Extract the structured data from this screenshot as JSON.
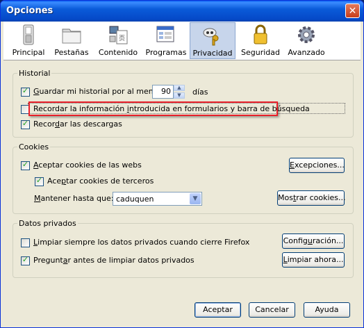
{
  "window": {
    "title": "Opciones",
    "close_glyph": "✕"
  },
  "toolbar": {
    "items": [
      {
        "label": "Principal",
        "icon": "switch-icon"
      },
      {
        "label": "Pestañas",
        "icon": "folder-tabs-icon"
      },
      {
        "label": "Contenido",
        "icon": "content-icon"
      },
      {
        "label": "Programas",
        "icon": "applications-icon"
      },
      {
        "label": "Privacidad",
        "icon": "mask-key-icon",
        "active": true
      },
      {
        "label": "Seguridad",
        "icon": "lock-icon"
      },
      {
        "label": "Avanzado",
        "icon": "gear-icon"
      }
    ]
  },
  "historial": {
    "legend": "Historial",
    "save_history": {
      "pre": "",
      "ul": "G",
      "post": "uardar mi historial por al menos",
      "checked": true
    },
    "days_value": "90",
    "days_label": "días",
    "remember_forms": {
      "pre": "Recordar la información ",
      "ul": "i",
      "post": "ntroducida en formularios y barra de búsqueda",
      "checked": false
    },
    "remember_downloads": {
      "pre": "Recor",
      "ul": "d",
      "post": "ar las descargas",
      "checked": true
    }
  },
  "cookies": {
    "legend": "Cookies",
    "accept_cookies": {
      "pre": "",
      "ul": "A",
      "post": "ceptar cookies de las webs",
      "checked": true
    },
    "exceptions_button": {
      "pre": "",
      "ul": "E",
      "post": "xcepciones..."
    },
    "third_party": {
      "pre": "Ace",
      "ul": "p",
      "post": "tar cookies de terceros",
      "checked": true
    },
    "keep_until": {
      "pre": "",
      "ul": "M",
      "post": "antener hasta que:"
    },
    "keep_until_value": "caduquen",
    "show_cookies_button": {
      "pre": "Mos",
      "ul": "t",
      "post": "rar cookies..."
    }
  },
  "private_data": {
    "legend": "Datos privados",
    "always_clear": {
      "pre": "",
      "ul": "L",
      "post": "impiar siempre los datos privados cuando cierre Firefox",
      "checked": false
    },
    "settings_button": {
      "pre": "Config",
      "ul": "u",
      "post": "ración..."
    },
    "ask_before": {
      "pre": "Pregunt",
      "ul": "a",
      "post": "r antes de limpiar datos privados",
      "checked": true
    },
    "clear_now_button": {
      "pre": "",
      "ul": "L",
      "post": "impiar ahora..."
    }
  },
  "footer": {
    "accept": "Aceptar",
    "cancel": "Cancelar",
    "help": "Ayuda"
  },
  "colors": {
    "highlight_box": "#e8202a",
    "title_bar": "#0a5bd9",
    "dialog_bg": "#ece9d8"
  }
}
